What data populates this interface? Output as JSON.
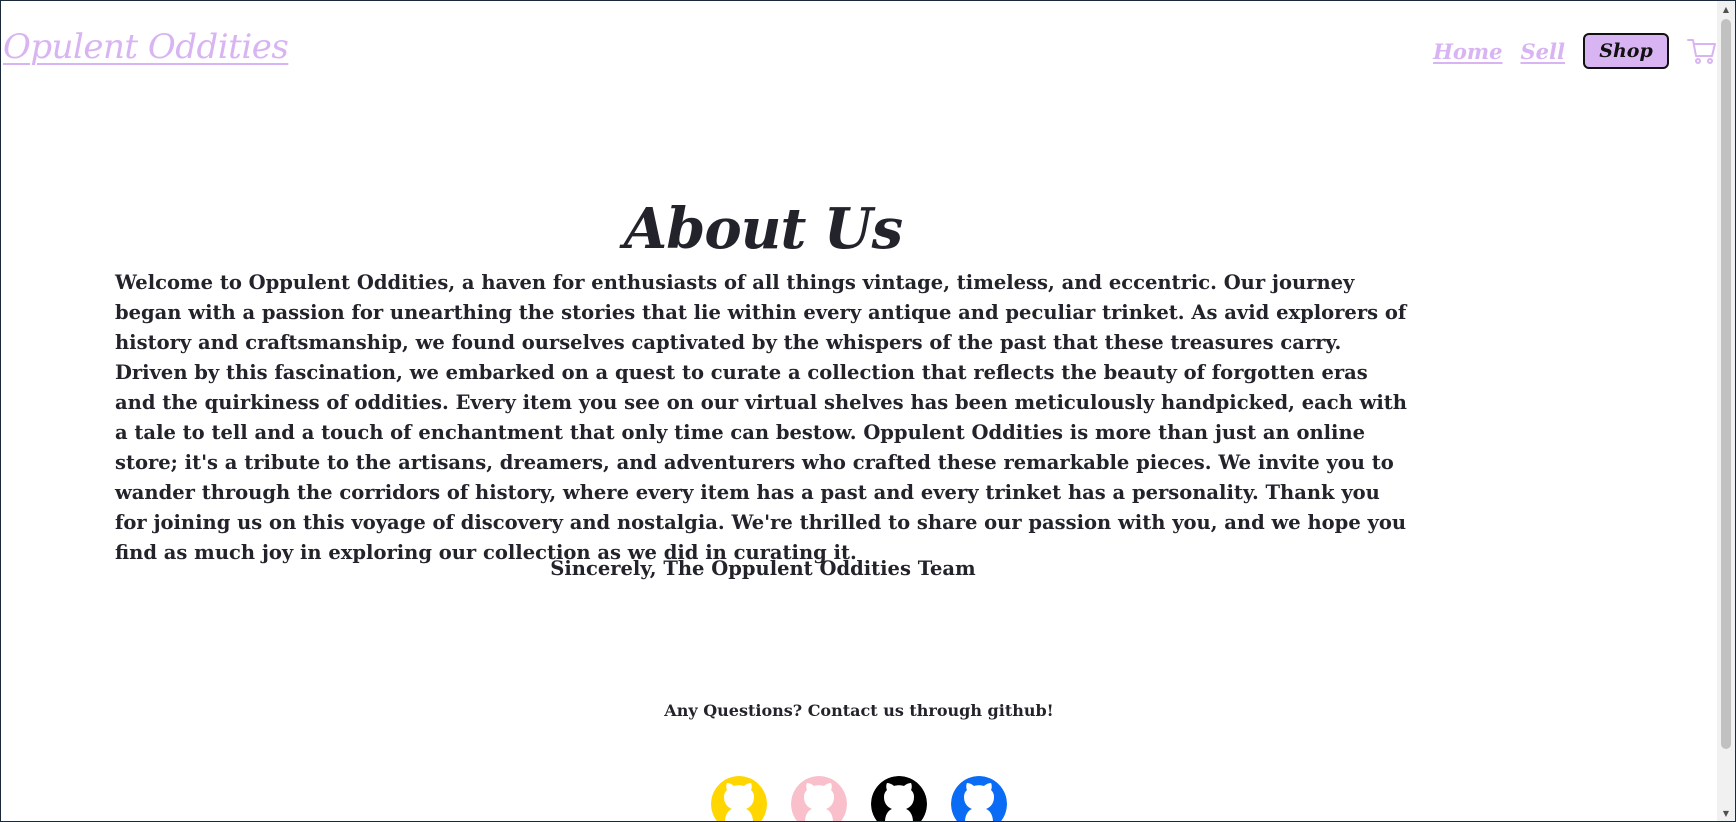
{
  "header": {
    "logo": "Opulent Oddities",
    "nav": {
      "home_label": "Home",
      "sell_label": "Sell",
      "shop_label": "Shop",
      "cart_icon": "shopping-cart-icon"
    }
  },
  "about": {
    "title": "About Us",
    "body": "Welcome to Oppulent Oddities, a haven for enthusiasts of all things vintage, timeless, and eccentric. Our journey began with a passion for unearthing the stories that lie within every antique and peculiar trinket. As avid explorers of history and craftsmanship, we found ourselves captivated by the whispers of the past that these treasures carry. Driven by this fascination, we embarked on a quest to curate a collection that reflects the beauty of forgotten eras and the quirkiness of oddities. Every item you see on our virtual shelves has been meticulously handpicked, each with a tale to tell and a touch of enchantment that only time can bestow. Oppulent Oddities is more than just an online store; it's a tribute to the artisans, dreamers, and adventurers who crafted these remarkable pieces. We invite you to wander through the corridors of history, where every item has a past and every trinket has a personality. Thank you for joining us on this voyage of discovery and nostalgia. We're thrilled to share our passion with you, and we hope you find as much joy in exploring our collection as we did in curating it.",
    "signoff": "Sincerely, The Oppulent Oddities Team"
  },
  "footer": {
    "contact_text": "Any Questions? Contact us through github!",
    "github_links": [
      {
        "icon": "github-icon",
        "color": "#ffd600"
      },
      {
        "icon": "github-icon",
        "color": "#f9c0cb"
      },
      {
        "icon": "github-icon",
        "color": "#000000"
      },
      {
        "icon": "github-icon",
        "color": "#0a6cf5"
      }
    ]
  },
  "colors": {
    "accent": "#d8b4f2",
    "text": "#23242b",
    "background": "#ffffff"
  }
}
